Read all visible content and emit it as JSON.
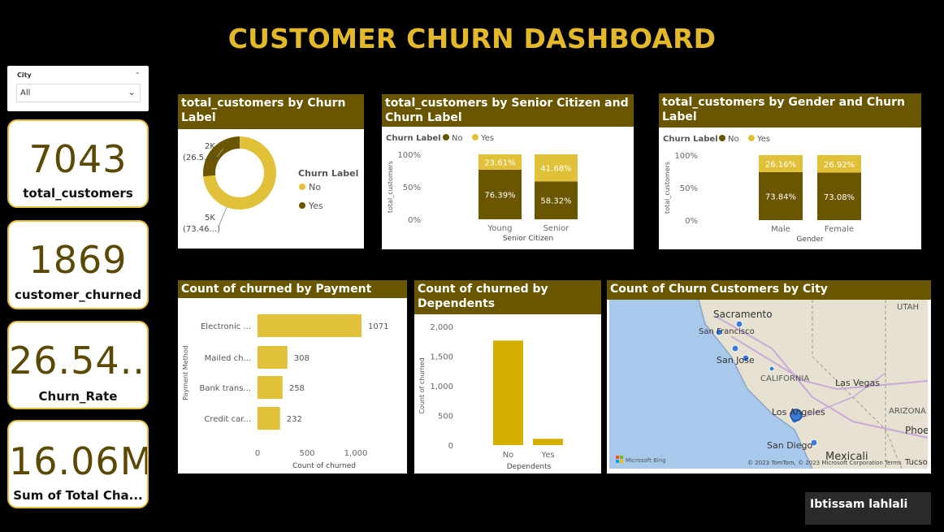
{
  "title": "CUSTOMER CHURN DASHBOARD",
  "slicer": {
    "label": "City",
    "value": "All"
  },
  "kpis": [
    {
      "value": "7043",
      "caption": "total_customers"
    },
    {
      "value": "1869",
      "caption": "customer_churned"
    },
    {
      "value": "26.54...",
      "caption": "Churn_Rate"
    },
    {
      "value": "16.06M",
      "caption": "Sum of Total Cha..."
    }
  ],
  "colors": {
    "accent": "#e4b929",
    "dark": "#6b5600",
    "no": "#6b5600",
    "yes": "#e2c13a",
    "bar": "#e2c13a",
    "dep_bar": "#d4ae00"
  },
  "visuals": {
    "churn_label": {
      "title": "total_customers by Churn Label"
    },
    "senior": {
      "title": "total_customers by Senior Citizen and Churn Label"
    },
    "gender": {
      "title": "total_customers by Gender and Churn Label"
    },
    "payment": {
      "title": "Count of churned by Payment Method"
    },
    "dependents": {
      "title": "Count of churned by Dependents"
    },
    "map": {
      "title": "Count of Churn Customers by City",
      "bing": "Microsoft Bing",
      "copyright": "© 2023 TomTom, © 2023 Microsoft Corporation  Terms"
    }
  },
  "chart_data": [
    {
      "type": "pie",
      "title": "total_customers by Churn Label",
      "legend_title": "Churn Label",
      "legend_position": "right",
      "categories": [
        "No",
        "Yes"
      ],
      "values": [
        5174,
        1869
      ],
      "data_labels": [
        "5K\n(73.46...)",
        "2K\n(26.5...)"
      ]
    },
    {
      "type": "bar",
      "stacked": "100%",
      "title": "total_customers by Senior Citizen and Churn Label",
      "legend_title": "Churn Label",
      "legend_position": "top-left",
      "categories": [
        "Young",
        "Senior"
      ],
      "series": [
        {
          "name": "No",
          "values": [
            76.39,
            58.32
          ]
        },
        {
          "name": "Yes",
          "values": [
            23.61,
            41.68
          ]
        }
      ],
      "xlabel": "Senior Citizen",
      "ylabel": "total_customers",
      "yticks": [
        "0%",
        "50%",
        "100%"
      ],
      "ylim": [
        0,
        100
      ]
    },
    {
      "type": "bar",
      "stacked": "100%",
      "title": "total_customers by Gender and Churn Label",
      "legend_title": "Churn Label",
      "legend_position": "top-left",
      "categories": [
        "Male",
        "Female"
      ],
      "series": [
        {
          "name": "No",
          "values": [
            73.84,
            73.08
          ]
        },
        {
          "name": "Yes",
          "values": [
            26.16,
            26.92
          ]
        }
      ],
      "xlabel": "Gender",
      "ylabel": "total_customers",
      "yticks": [
        "0%",
        "50%",
        "100%"
      ],
      "ylim": [
        0,
        100
      ]
    },
    {
      "type": "bar",
      "orientation": "horizontal",
      "title": "Count of churned by Payment Method",
      "categories": [
        "Electronic ...",
        "Mailed ch...",
        "Bank trans...",
        "Credit car..."
      ],
      "values": [
        1071,
        308,
        258,
        232
      ],
      "xlabel": "Count of churned",
      "ylabel": "Payment Method",
      "xticks": [
        "0",
        "500",
        "1,000"
      ],
      "xlim": [
        0,
        1200
      ]
    },
    {
      "type": "bar",
      "title": "Count of churned by Dependents",
      "categories": [
        "No",
        "Yes"
      ],
      "values": [
        1763,
        106
      ],
      "xlabel": "Dependents",
      "ylabel": "Count of churned",
      "yticks": [
        "0",
        "500",
        "1,000",
        "1,500",
        "2,000"
      ],
      "ylim": [
        0,
        2000
      ]
    }
  ],
  "map_labels": [
    "Sacramento",
    "San Francisco",
    "San Jose",
    "CALIFORNIA",
    "Las Vegas",
    "Los Angeles",
    "San Diego",
    "Mexicali",
    "ARIZONA",
    "UTAH",
    "Phoe",
    "Tucso"
  ],
  "author": "Ibtissam lahlali"
}
